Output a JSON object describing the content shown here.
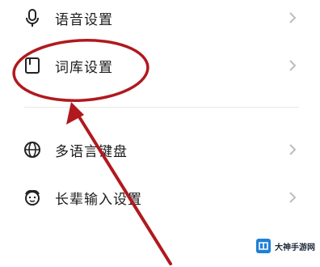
{
  "settings": {
    "items": [
      {
        "label": "语音设置",
        "icon": "microphone-icon"
      },
      {
        "label": "词库设置",
        "icon": "dictionary-icon"
      },
      {
        "label": "多语言键盘",
        "icon": "globe-icon"
      },
      {
        "label": "长辈输入设置",
        "icon": "elder-face-icon"
      }
    ]
  },
  "annotation": {
    "color": "#b0191e"
  },
  "watermark": {
    "text": "大神手游网"
  }
}
